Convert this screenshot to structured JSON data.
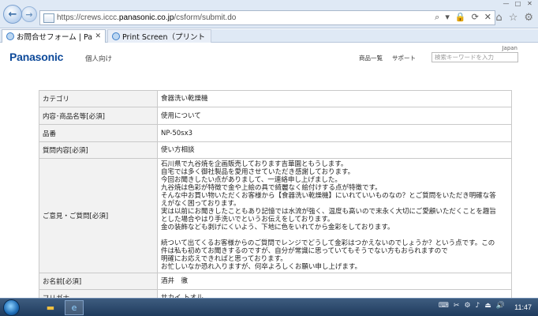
{
  "browser": {
    "url_prefix": "https://crews.iccc.",
    "url_host": "panasonic.co.jp",
    "url_path": "/csform/submit.do",
    "url_tools": [
      "⌕",
      "▾",
      "🔒",
      "⟳",
      "✕"
    ],
    "tabs": [
      {
        "label": "お問合せフォーム | Pana...",
        "close": "✕"
      },
      {
        "label": "Print Screen（プリントスク...",
        "close": ""
      }
    ]
  },
  "site": {
    "logo": "Panasonic",
    "personal": "個人向け",
    "country": "Japan",
    "nav": [
      "商品一覧",
      "サポート"
    ],
    "search_placeholder": "検索キーワードを入力"
  },
  "form": {
    "rows": [
      {
        "label": "カテゴリ",
        "value": "食器洗い乾燥機"
      },
      {
        "label": "内容･商品名等[必須]",
        "value": "使用について"
      },
      {
        "label": "品番",
        "value": "NP-50sx3"
      },
      {
        "label": "質問内容[必須]",
        "value": "使い方相談"
      }
    ],
    "opinion_label": "ご意見・ご質問[必須]",
    "opinion_lines": [
      "石川県で九谷焼を企画販売しております吉華園ともうします。",
      "自宅では多く御社製品を愛用させていただき感謝しております。",
      "今回お聞きしたい点がありまして、一連絡申し上げました。",
      "九谷焼は色彩が特徴で金や上絵の具で綺麗なく絵付けする点が特徴です。",
      "そんな中お買い物いただくお客様から【食器洗い乾燥機】にいれていいものなの？とご質問をいただき明確な答",
      "えがなく困っております。",
      "実は以前にお聞きしたこともあり記憶では水流が強く、温度も高いので末永く大切にご愛顧いただくことを趣旨",
      "とした場合やはり手洗いでというお伝えをしております。",
      "金の装飾なども剥げにくいよう、下地に色をいれてから金彩をしております。",
      "",
      "続ついて出てくるお客様からのご質問でレンジでどうして金彩はつかえないのでしょうか？という点です。この",
      "件は私も初めてお聞きするのですが、自分が常識に思っていてもそうでない方もおられますので",
      "明確にお応えできればと思っております。",
      "お忙しいなか恐れ入りますが、何卒よろしくお願い申し上げます。"
    ],
    "name_label": "お名前[必須]",
    "name_value": "酒井　徹",
    "kana_label": "フリガナ",
    "kana_value": "サカイ トオル"
  },
  "taskbar": {
    "tray": [
      "⌨",
      "✂",
      "⚙",
      "♪",
      "⏏",
      "🔊"
    ],
    "clock": "11:47"
  }
}
